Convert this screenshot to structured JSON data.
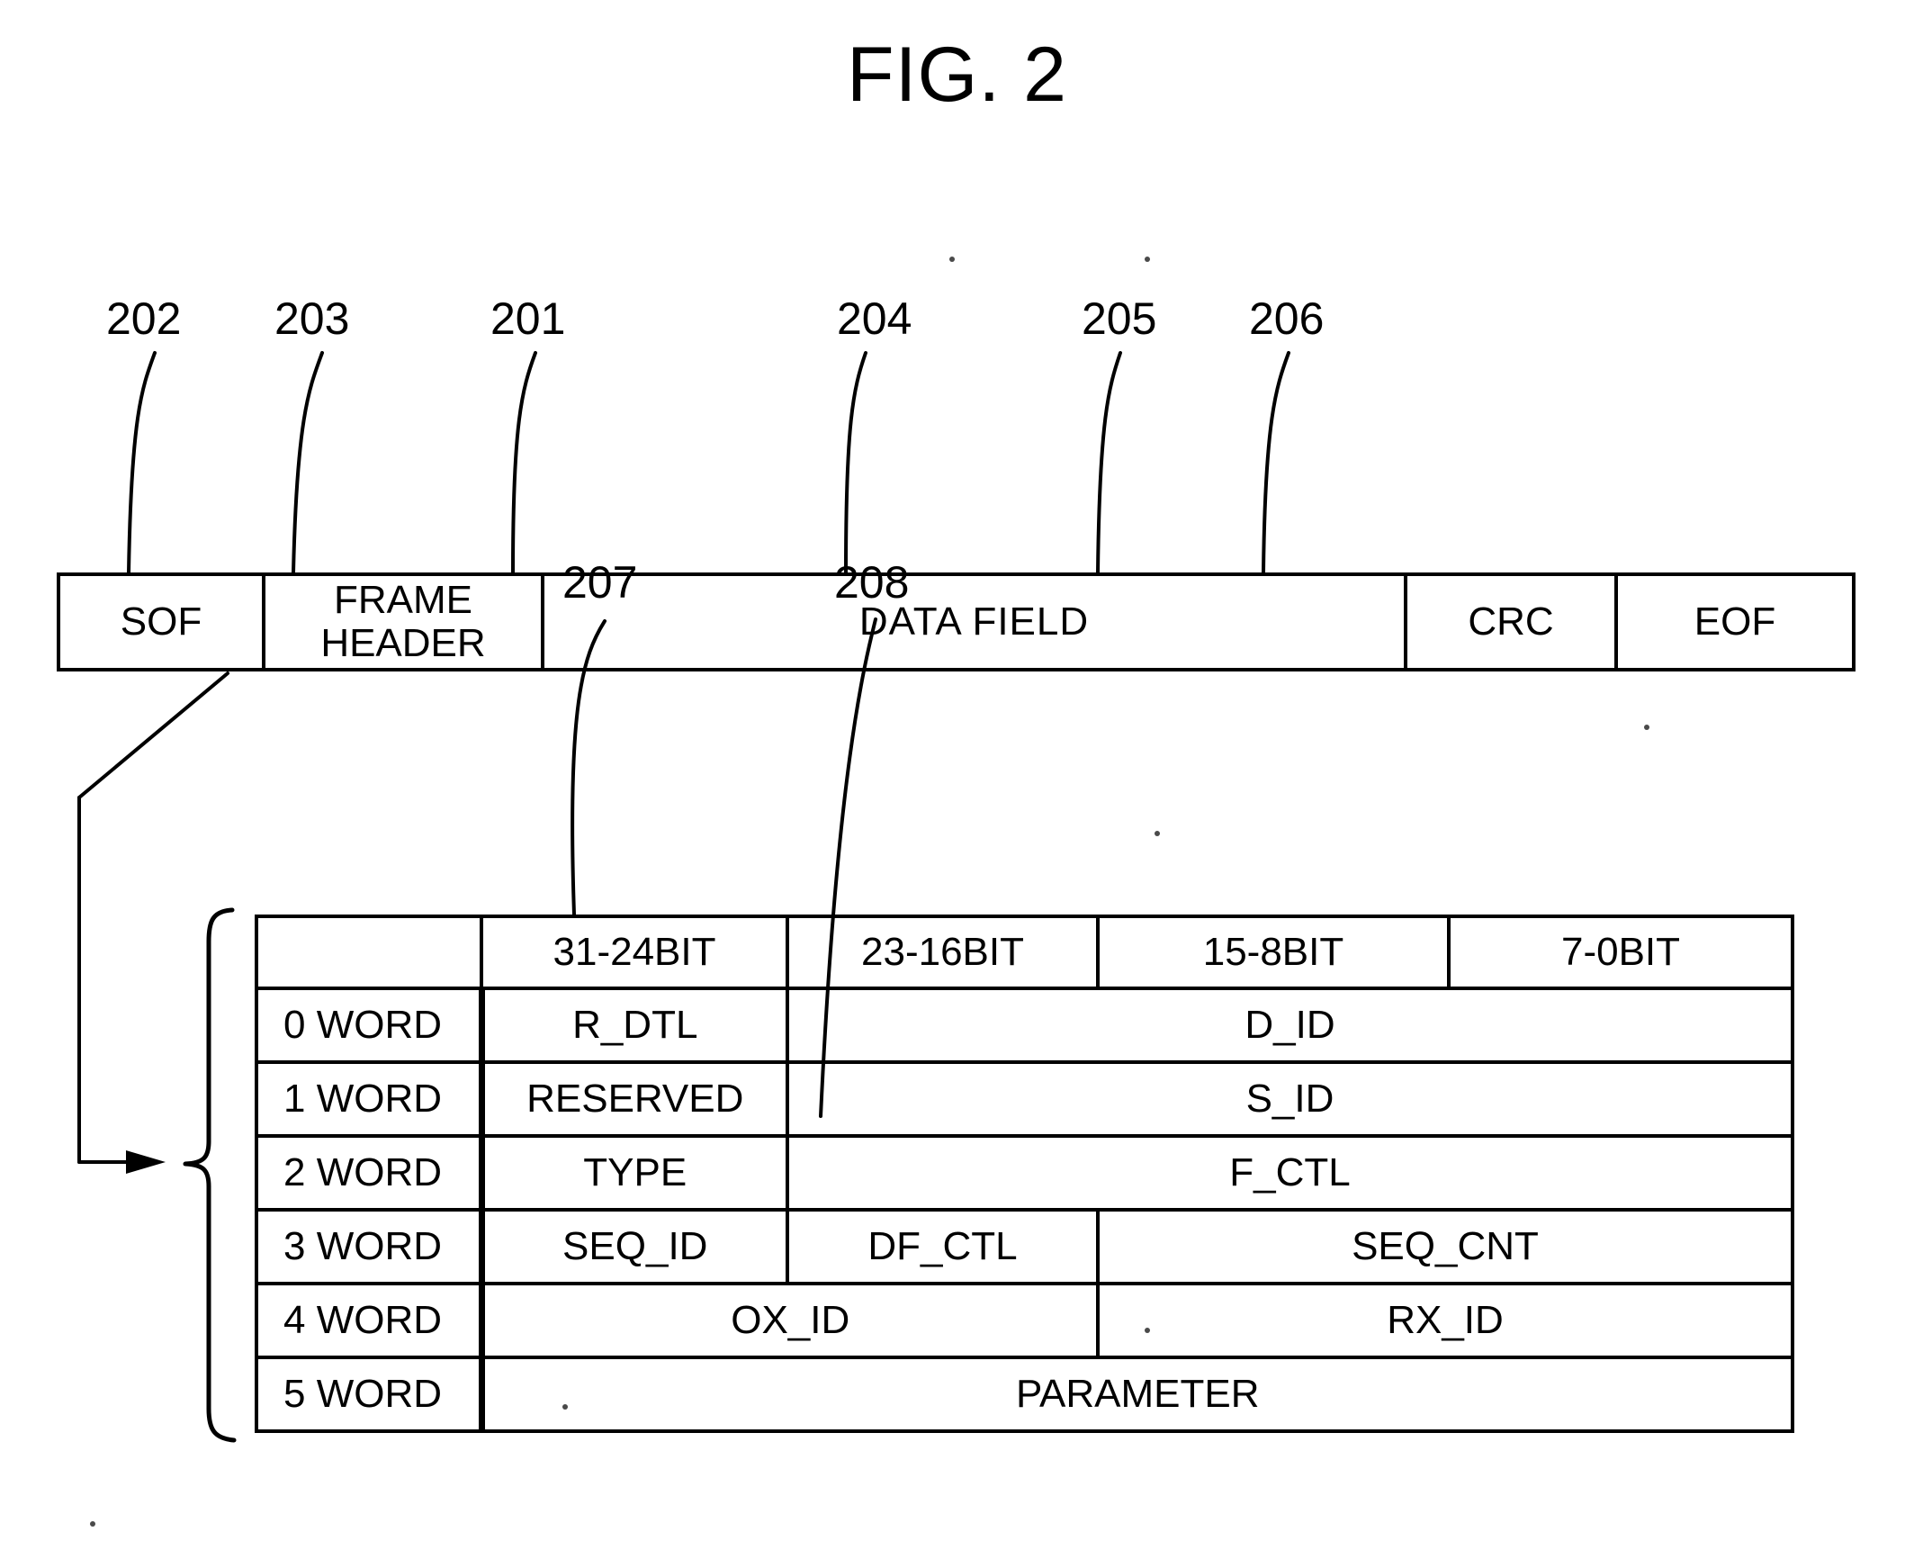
{
  "figure": {
    "title": "FIG. 2"
  },
  "reference_numbers": [
    {
      "id": "202",
      "label": "202"
    },
    {
      "id": "203",
      "label": "203"
    },
    {
      "id": "201",
      "label": "201"
    },
    {
      "id": "204",
      "label": "204"
    },
    {
      "id": "205",
      "label": "205"
    },
    {
      "id": "206",
      "label": "206"
    },
    {
      "id": "207",
      "label": "207"
    },
    {
      "id": "208",
      "label": "208"
    }
  ],
  "frame_bar": {
    "cells": [
      {
        "key": "sof",
        "label": "SOF"
      },
      {
        "key": "frame_header",
        "label": "FRAME\nHEADER"
      },
      {
        "key": "data_field",
        "label": "DATA  FIELD"
      },
      {
        "key": "crc",
        "label": "CRC"
      },
      {
        "key": "eof",
        "label": "EOF"
      }
    ]
  },
  "detail_table": {
    "column_headers": [
      "",
      "31-24BIT",
      "23-16BIT",
      "15-8BIT",
      "7-0BIT"
    ],
    "rows": [
      {
        "word": "0 WORD",
        "cells": [
          {
            "text": "R_DTL",
            "span": 1
          },
          {
            "text": "D_ID",
            "span": 3
          }
        ]
      },
      {
        "word": "1 WORD",
        "cells": [
          {
            "text": "RESERVED",
            "span": 1
          },
          {
            "text": "S_ID",
            "span": 3
          }
        ]
      },
      {
        "word": "2 WORD",
        "cells": [
          {
            "text": "TYPE",
            "span": 1
          },
          {
            "text": "F_CTL",
            "span": 3
          }
        ]
      },
      {
        "word": "3 WORD",
        "cells": [
          {
            "text": "SEQ_ID",
            "span": 1
          },
          {
            "text": "DF_CTL",
            "span": 1
          },
          {
            "text": "SEQ_CNT",
            "span": 2
          }
        ]
      },
      {
        "word": "4 WORD",
        "cells": [
          {
            "text": "OX_ID",
            "span": 2
          },
          {
            "text": "RX_ID",
            "span": 2
          }
        ]
      },
      {
        "word": "5 WORD",
        "cells": [
          {
            "text": "PARAMETER",
            "span": 4
          }
        ]
      }
    ]
  },
  "colors": {
    "ink": "#000000",
    "paper": "#ffffff"
  }
}
